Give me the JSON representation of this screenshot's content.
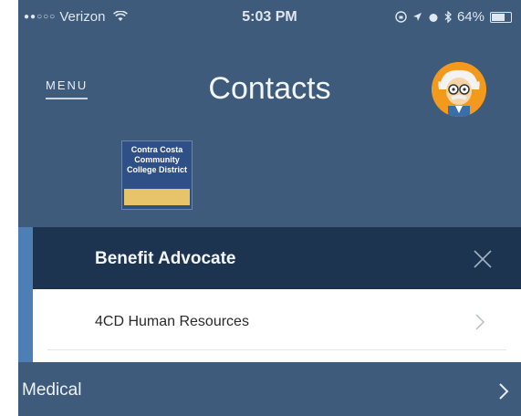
{
  "status_bar": {
    "signal_dots": "●●○○○",
    "carrier": "Verizon",
    "wifi_icon": "wifi-icon",
    "time": "5:03 PM",
    "battery_percent": "64%",
    "battery_level": 0.64
  },
  "header": {
    "menu_label": "MENU",
    "title": "Contacts"
  },
  "logo": {
    "text_lines": [
      "Contra Costa",
      "Community",
      "College District"
    ]
  },
  "section": {
    "title": "Benefit Advocate"
  },
  "rows": [
    {
      "label": "4CD Human Resources"
    }
  ],
  "medical": {
    "label": "Medical"
  },
  "colors": {
    "background": "#3e5b7b",
    "section_band": "#1c344f",
    "accent": "#4e7fb4",
    "avatar_bg": "#f39a1c"
  }
}
